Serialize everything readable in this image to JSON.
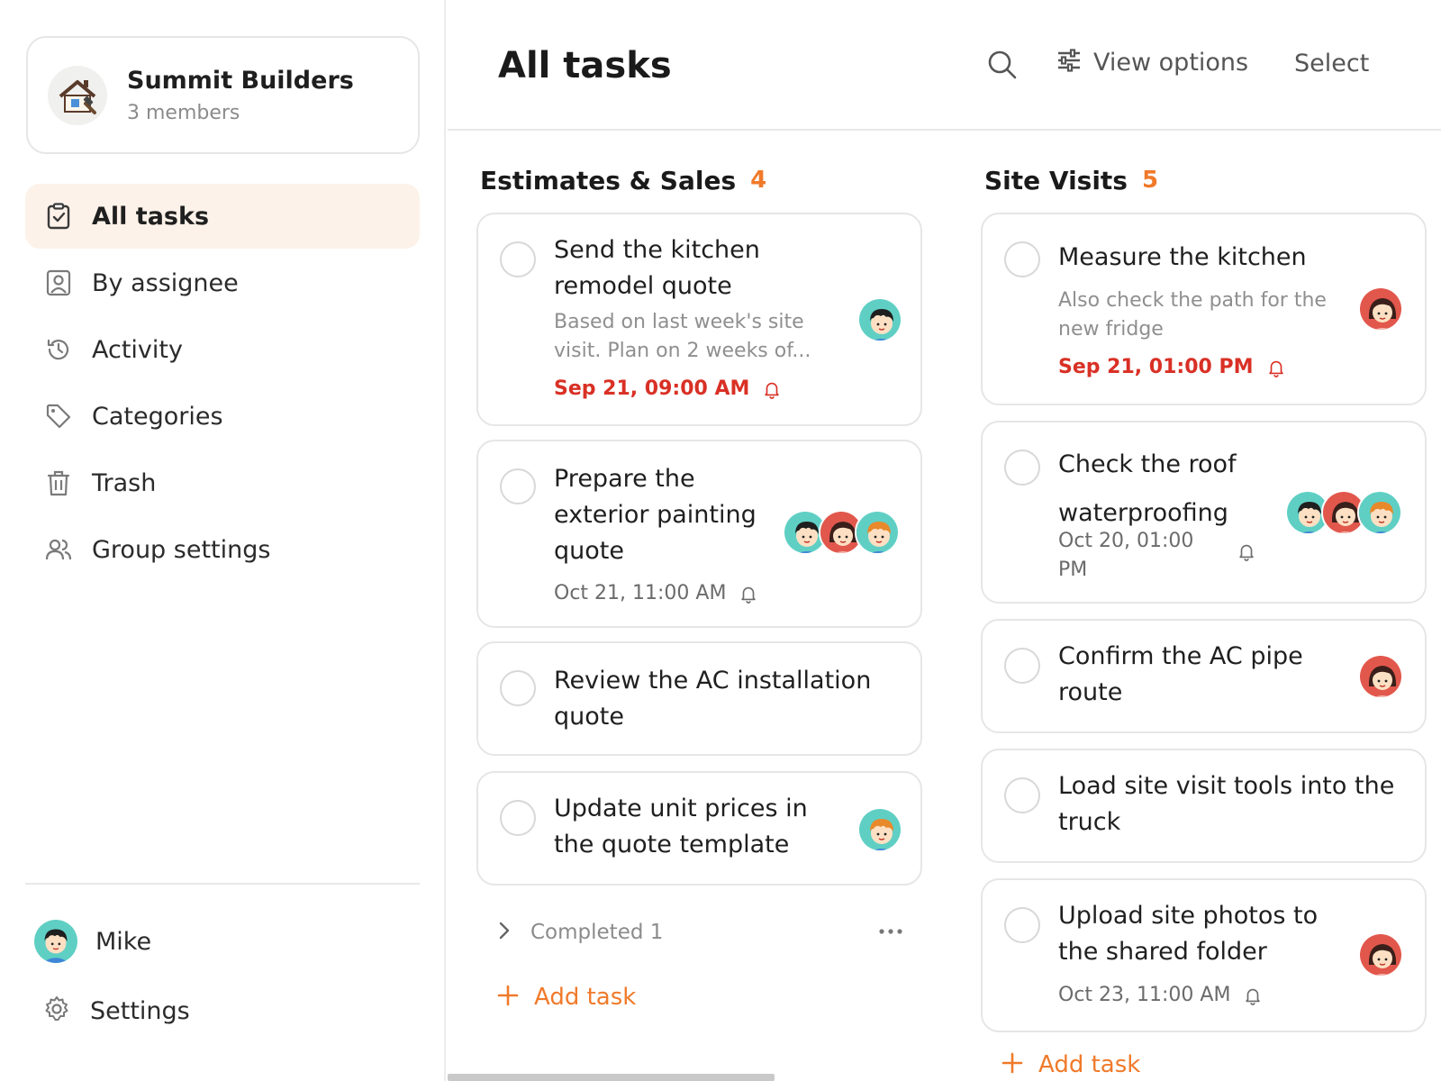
{
  "team": {
    "name": "Summit Builders",
    "members": "3 members",
    "logo_icon": "house-hammer-icon"
  },
  "nav": [
    {
      "label": "All tasks",
      "icon": "clipboard-check-icon",
      "active": true
    },
    {
      "label": "By assignee",
      "icon": "person-badge-icon",
      "active": false
    },
    {
      "label": "Activity",
      "icon": "history-icon",
      "active": false
    },
    {
      "label": "Categories",
      "icon": "tag-icon",
      "active": false
    },
    {
      "label": "Trash",
      "icon": "trash-icon",
      "active": false
    },
    {
      "label": "Group settings",
      "icon": "people-icon",
      "active": false
    }
  ],
  "user": {
    "name": "Mike"
  },
  "settings_label": "Settings",
  "header": {
    "title": "All tasks",
    "view_options": "View options",
    "select": "Select"
  },
  "columns": [
    {
      "title": "Estimates & Sales",
      "count": "4",
      "tasks": [
        {
          "title": "Send the kitchen remodel quote",
          "desc": "Based on last week's site visit. Plan on 2 weeks of...",
          "date": "Sep 21, 09:00 AM",
          "overdue": true,
          "assignees": [
            "mike"
          ]
        },
        {
          "title": "Prepare the exterior painting quote",
          "date": "Oct 21, 11:00 AM",
          "overdue": false,
          "assignees": [
            "mike",
            "woman",
            "orange"
          ]
        },
        {
          "title": "Review the AC installation quote",
          "assignees": []
        },
        {
          "title": "Update unit prices in the quote template",
          "assignees": [
            "orange"
          ]
        }
      ],
      "completed_label": "Completed 1",
      "add_task": "Add task"
    },
    {
      "title": "Site Visits",
      "count": "5",
      "tasks": [
        {
          "title": "Measure the kitchen",
          "desc": "Also check the path for the new fridge",
          "date": "Sep 21, 01:00 PM",
          "overdue": true,
          "assignees": [
            "woman"
          ]
        },
        {
          "title": "Check the roof waterproofing",
          "date": "Oct 20, 01:00 PM",
          "overdue": false,
          "assignees": [
            "mike",
            "woman",
            "orange"
          ]
        },
        {
          "title": "Confirm the AC pipe route",
          "assignees": [
            "woman"
          ]
        },
        {
          "title": "Load site visit tools into the truck",
          "assignees": []
        },
        {
          "title": "Upload site photos to the shared folder",
          "date": "Oct 23, 11:00 AM",
          "overdue": false,
          "assignees": [
            "woman"
          ]
        }
      ],
      "add_task": "Add task"
    }
  ],
  "colors": {
    "accent": "#f07a2a",
    "overdue": "#d93025",
    "active_nav_bg": "#fdf2e9"
  }
}
